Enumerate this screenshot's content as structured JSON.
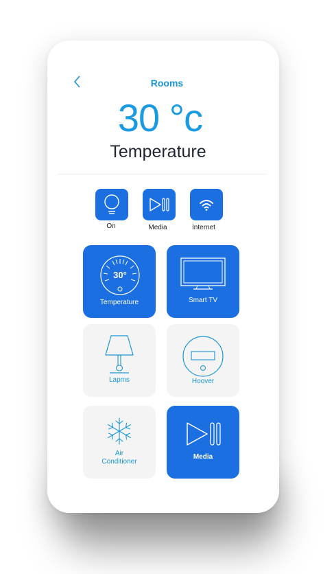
{
  "header": {
    "title": "Rooms"
  },
  "temperature": {
    "value": "30 °c",
    "label": "Temperature"
  },
  "quick_actions": [
    {
      "label": "On",
      "icon": "bulb-icon"
    },
    {
      "label": "Media",
      "icon": "play-pause-icon"
    },
    {
      "label": "Internet",
      "icon": "wifi-icon"
    }
  ],
  "tiles": [
    {
      "label": "Temperature",
      "icon": "thermostat-icon",
      "active": true,
      "dial_value": "30°"
    },
    {
      "label": "Smart TV",
      "icon": "tv-icon",
      "active": true
    },
    {
      "label": "Lapms",
      "icon": "lamp-icon",
      "active": false
    },
    {
      "label": "Hoover",
      "icon": "robot-vacuum-icon",
      "active": false
    },
    {
      "label": "Air\nConditioner",
      "icon": "snowflake-icon",
      "active": false
    },
    {
      "label": "Media",
      "icon": "play-pause-icon",
      "active": true
    }
  ],
  "colors": {
    "accent": "#1c6fe0",
    "title": "#1a96d6",
    "tile_inactive": "#f4f4f4"
  }
}
